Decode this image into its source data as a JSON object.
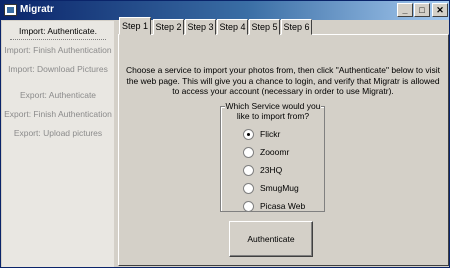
{
  "window": {
    "title": "Migratr",
    "buttons": {
      "minimize": "_",
      "maximize": "□",
      "close": "✕"
    }
  },
  "steps_pane": {
    "items": [
      {
        "label": "Import:  Authenticate.",
        "active": true
      },
      {
        "label": "Import:  Finish Authentication",
        "active": false
      },
      {
        "label": "Import:  Download Pictures",
        "active": false
      },
      {
        "label": "Export:  Authenticate",
        "active": false
      },
      {
        "label": "Export:  Finish Authentication",
        "active": false
      },
      {
        "label": "Export:  Upload pictures",
        "active": false
      }
    ]
  },
  "tabs": [
    {
      "label": "Step 1",
      "active": true
    },
    {
      "label": "Step 2",
      "active": false
    },
    {
      "label": "Step 3",
      "active": false
    },
    {
      "label": "Step 4",
      "active": false
    },
    {
      "label": "Step 5",
      "active": false
    },
    {
      "label": "Step 6",
      "active": false
    }
  ],
  "step1": {
    "instructions": "Choose a service to import your photos from, then click \"Authenticate\" below to visit the web page.  This will give you a chance to login, and verify that Migratr is allowed to access your account (necessary in order to use Migratr).",
    "service_group": {
      "title": "Which Service would you like to import from?",
      "options": [
        {
          "label": "Flickr",
          "selected": true
        },
        {
          "label": "Zooomr",
          "selected": false
        },
        {
          "label": "23HQ",
          "selected": false
        },
        {
          "label": "SmugMug",
          "selected": false
        },
        {
          "label": "Picasa Web",
          "selected": false
        }
      ]
    },
    "authenticate_label": "Authenticate"
  }
}
